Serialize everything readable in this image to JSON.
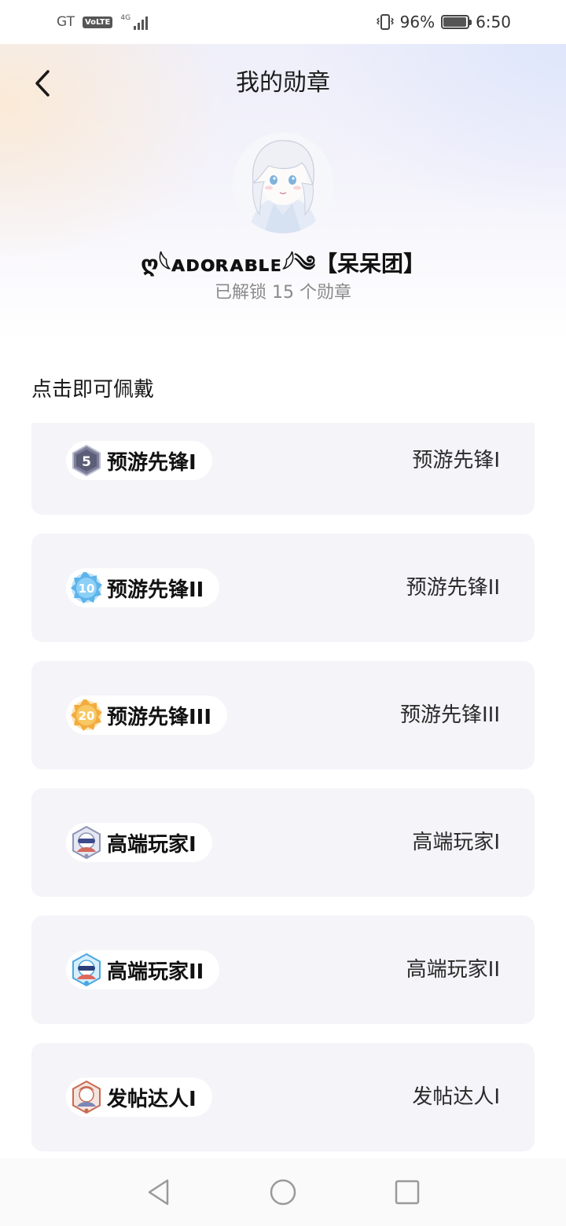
{
  "status_bar": {
    "carrier": "GT",
    "volte": "VoLTE",
    "network": "4G",
    "battery": "96%",
    "battery_level": 0.96,
    "time": "6:50"
  },
  "header": {
    "title": "我的勋章",
    "back_icon": "chevron-left-icon"
  },
  "profile": {
    "username": "ღ𓆩ᴀᴅᴏʀᴀʙʟᴇ𓆪༄【呆呆团】",
    "unlock_summary": "已解锁 15 个勋章"
  },
  "section": {
    "title": "点击即可佩戴"
  },
  "badges": [
    {
      "pill_label": "预游先锋I",
      "name": "预游先锋I",
      "icon": "hexagon-5-badge-icon",
      "color": "#7d7f9a"
    },
    {
      "pill_label": "预游先锋II",
      "name": "预游先锋II",
      "icon": "gear-10-badge-icon",
      "color": "#5db3ea"
    },
    {
      "pill_label": "预游先锋III",
      "name": "预游先锋III",
      "icon": "gear-20-badge-icon",
      "color": "#f2ac3e"
    },
    {
      "pill_label": "高端玩家I",
      "name": "高端玩家I",
      "icon": "character-silver-badge-icon",
      "color": "#8e95b6"
    },
    {
      "pill_label": "高端玩家II",
      "name": "高端玩家II",
      "icon": "character-blue-badge-icon",
      "color": "#4aa7e0"
    },
    {
      "pill_label": "发帖达人I",
      "name": "发帖达人I",
      "icon": "character-red-badge-icon",
      "color": "#c86b53"
    }
  ],
  "nav_bar": {
    "back_icon": "triangle-back-icon",
    "home_icon": "circle-home-icon",
    "recents_icon": "square-recents-icon"
  }
}
